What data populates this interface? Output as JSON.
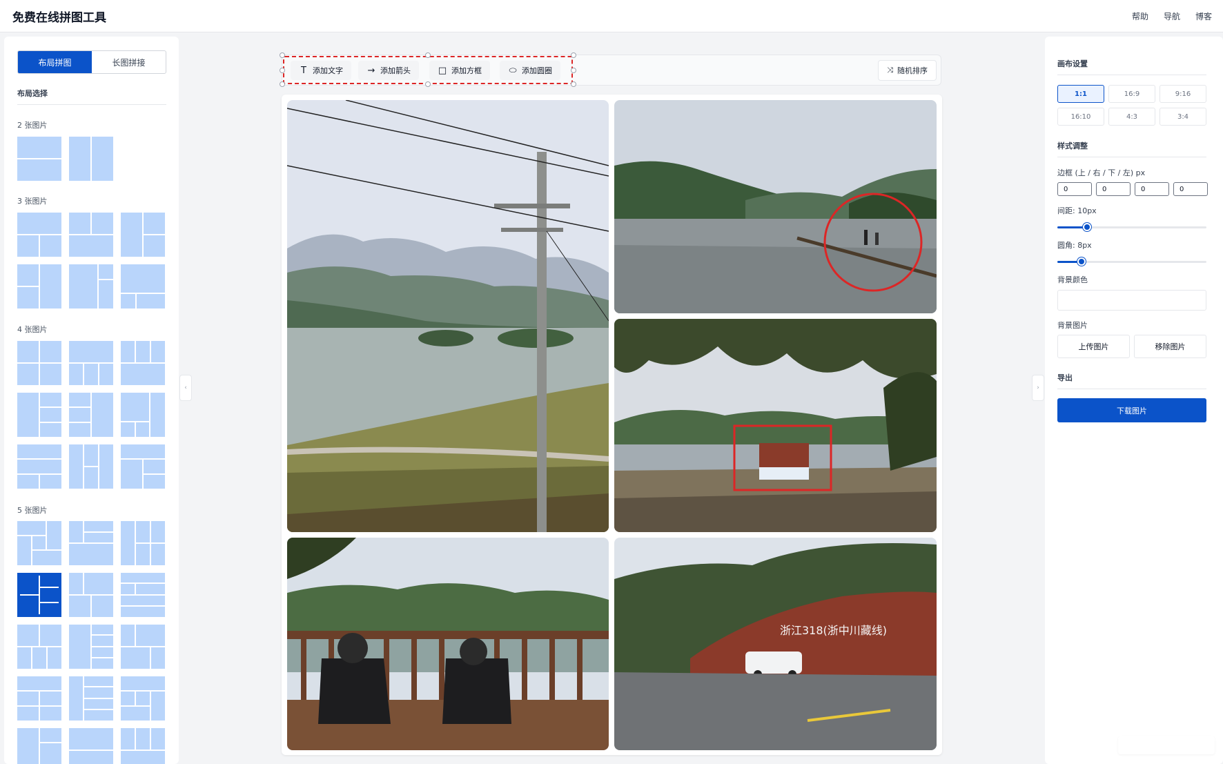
{
  "header": {
    "title": "免费在线拼图工具",
    "nav": [
      "帮助",
      "导航",
      "博客"
    ]
  },
  "left_panel": {
    "tabs": [
      {
        "label": "布局拼图",
        "active": true
      },
      {
        "label": "长图拼接",
        "active": false
      }
    ],
    "section_title": "布局选择",
    "groups": [
      {
        "label": "2 张图片"
      },
      {
        "label": "3 张图片"
      },
      {
        "label": "4 张图片"
      },
      {
        "label": "5 张图片"
      }
    ],
    "collapse_icon": "‹"
  },
  "toolbar": {
    "buttons": [
      {
        "label": "添加文字",
        "icon": "T"
      },
      {
        "label": "添加箭头",
        "icon": "→"
      },
      {
        "label": "添加方框",
        "icon": "□"
      },
      {
        "label": "添加圆圈",
        "icon": "⬭"
      }
    ],
    "shuffle_label": "随机排序",
    "shuffle_icon": "⤨"
  },
  "collage": {
    "photos": [
      {
        "scene": "power-pole-lake"
      },
      {
        "scene": "lake-pier-people"
      },
      {
        "scene": "lake-sign-under-trees"
      },
      {
        "scene": "two-people-deck-chairs"
      },
      {
        "scene": "zhejiang-318-sign-van"
      }
    ],
    "sign_text": "浙江318(浙中川藏线)"
  },
  "right_panel": {
    "canvas_title": "画布设置",
    "ratios": [
      {
        "label": "1:1",
        "active": true
      },
      {
        "label": "16:9",
        "active": false
      },
      {
        "label": "9:16",
        "active": false
      },
      {
        "label": "16:10",
        "active": false
      },
      {
        "label": "4:3",
        "active": false
      },
      {
        "label": "3:4",
        "active": false
      }
    ],
    "style_title": "样式调整",
    "border_label": "边框 (上 / 右 / 下 / 左) px",
    "border_values": [
      "0",
      "0",
      "0",
      "0"
    ],
    "gap_label": "间距: 10px",
    "gap_fraction": 0.2,
    "radius_label": "圆角: 8px",
    "radius_fraction": 0.16,
    "bg_color_label": "背景颜色",
    "bg_image_label": "背景图片",
    "upload_label": "上传图片",
    "remove_label": "移除图片",
    "export_title": "导出",
    "download_label": "下载图片",
    "collapse_icon": "›"
  },
  "colors": {
    "primary": "#0b53c9",
    "layout_tile": "#b9d5fb",
    "annotation_red": "#dc2626"
  }
}
